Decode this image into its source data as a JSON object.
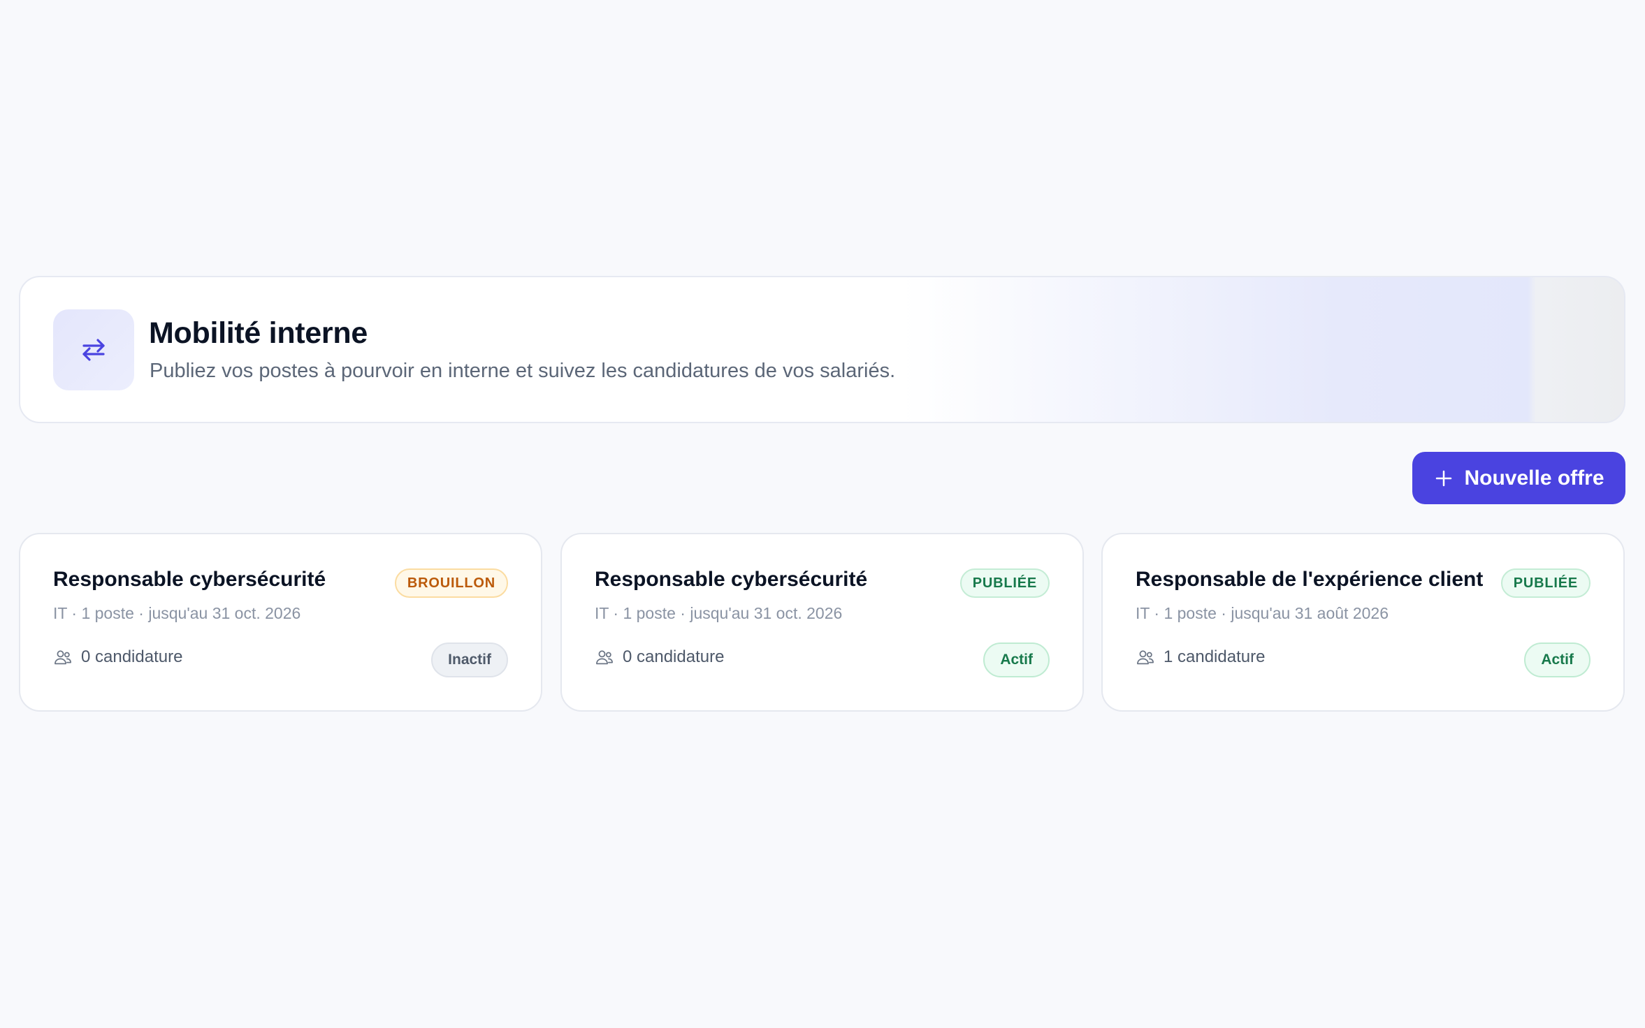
{
  "header": {
    "title": "Mobilité interne",
    "subtitle": "Publiez vos postes à pourvoir en interne et suivez les candidatures de vos salariés.",
    "icon": "swap-arrows-icon",
    "accent": "#4a43e0"
  },
  "actions": {
    "new_offer_label": "Nouvelle offre",
    "new_offer_icon": "plus-icon"
  },
  "offers": [
    {
      "title": "Responsable cybersécurité",
      "meta": "IT · 1 poste · jusqu'au 31 oct. 2026",
      "status": "BROUILLON",
      "applications": "0 candidature",
      "state": "Inactif"
    },
    {
      "title": "Responsable cybersécurité",
      "meta": "IT · 1 poste · jusqu'au 31 oct. 2026",
      "status": "PUBLIÉE",
      "applications": "0 candidature",
      "state": "Actif"
    },
    {
      "title": "Responsable de l'expérience client",
      "meta": "IT · 1 poste · jusqu'au 31 août 2026",
      "status": "PUBLIÉE",
      "applications": "1 candidature",
      "state": "Actif"
    }
  ],
  "colors": {
    "draft": "#bb5a0a",
    "published": "#17794b",
    "inactive": "#4f5a6a"
  }
}
